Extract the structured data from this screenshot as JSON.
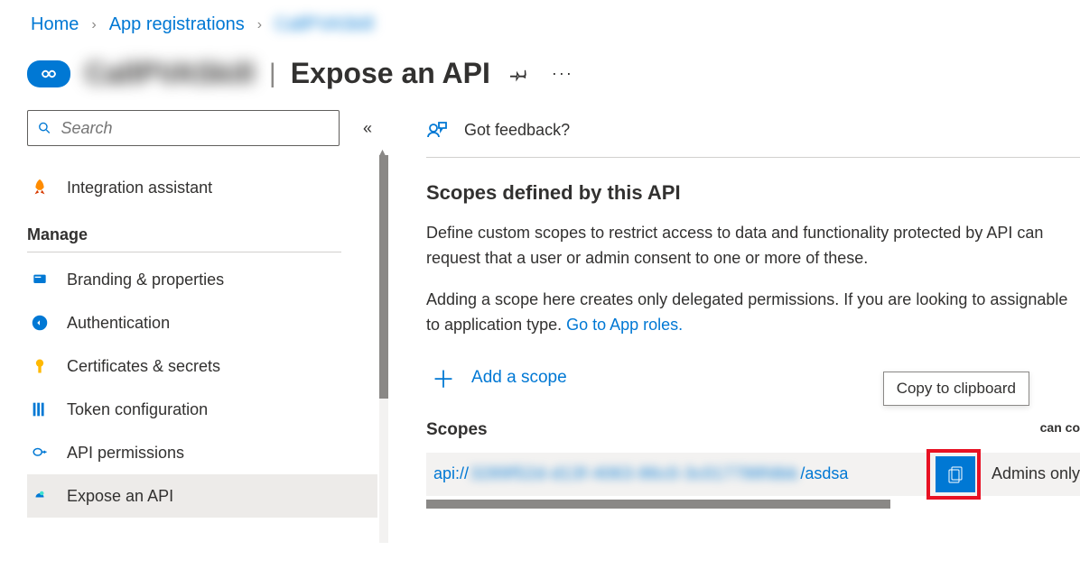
{
  "breadcrumb": {
    "home": "Home",
    "app_regs": "App registrations",
    "current": "CallPVASkill"
  },
  "header": {
    "app_name": "CallPVASkill",
    "page_title": "Expose an API"
  },
  "sidebar": {
    "search_placeholder": "Search",
    "integration": "Integration assistant",
    "manage_title": "Manage",
    "items": {
      "branding": "Branding & properties",
      "authentication": "Authentication",
      "certs": "Certificates & secrets",
      "token": "Token configuration",
      "api_perms": "API permissions",
      "expose": "Expose an API"
    }
  },
  "main": {
    "feedback": "Got feedback?",
    "section_title": "Scopes defined by this API",
    "para1": "Define custom scopes to restrict access to data and functionality protected by API can request that a user or admin consent to one or more of these.",
    "para2_a": "Adding a scope here creates only delegated permissions. If you are looking to assignable to application type. ",
    "para2_link": "Go to App roles.",
    "add_scope": "Add a scope",
    "scopes_label": "Scopes",
    "who_can_col": "can co",
    "scope_prefix": "api://",
    "scope_guid": "3289f52d-d13f-4063-86c0-3c017788fdbb",
    "scope_suffix": "/asdsa",
    "who_can_value": "Admins only",
    "tooltip": "Copy to clipboard"
  }
}
